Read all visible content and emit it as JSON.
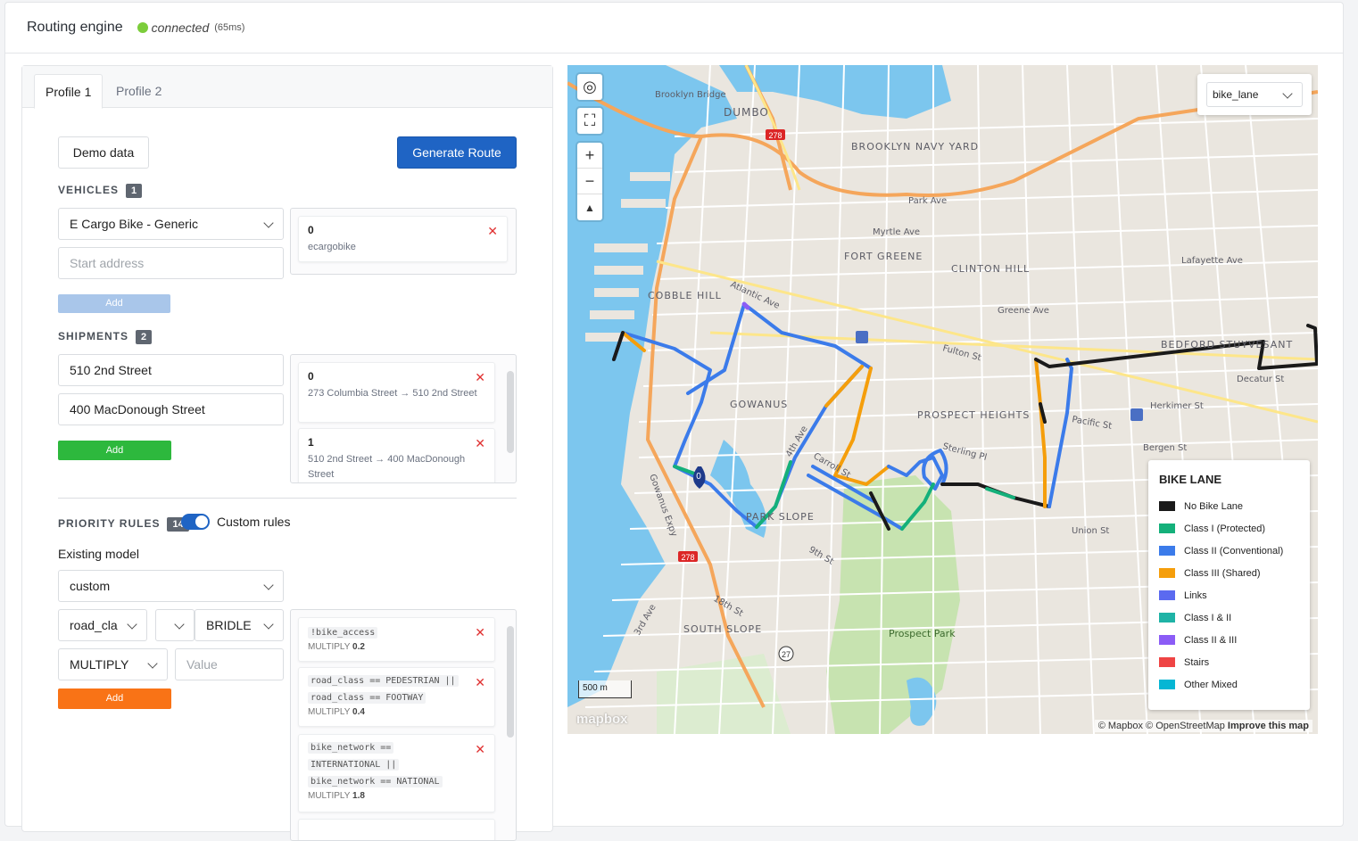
{
  "header": {
    "title": "Routing engine",
    "status": "connected",
    "latency": "(65ms)",
    "status_color": "#7ccd3b"
  },
  "tabs": [
    {
      "label": "Profile 1",
      "active": true
    },
    {
      "label": "Profile 2",
      "active": false
    }
  ],
  "toolbar": {
    "demo_label": "Demo data",
    "generate_label": "Generate Route"
  },
  "vehicles": {
    "label": "VEHICLES",
    "count": "1",
    "selected_type": "E Cargo Bike - Generic",
    "start_placeholder": "Start address",
    "add_label": "Add",
    "cards": [
      {
        "id": "0",
        "sub": "ecargobike"
      }
    ]
  },
  "shipments": {
    "label": "SHIPMENTS",
    "count": "2",
    "field1": "510 2nd Street",
    "field2": "400 MacDonough Street",
    "add_label": "Add",
    "cards": [
      {
        "id": "0",
        "sub": "273 Columbia Street → 510 2nd Street"
      },
      {
        "id": "1",
        "sub": "510 2nd Street → 400 MacDonough Street"
      }
    ]
  },
  "priority": {
    "label": "PRIORITY RULES",
    "count": "14",
    "toggle_label": "Custom rules",
    "toggle_on": true,
    "model_label": "Existing model",
    "model_value": "custom",
    "key_value": "road_cla",
    "op_value": "",
    "val_value": "BRIDLE",
    "action_value": "MULTIPLY",
    "value_placeholder": "Value",
    "add_label": "Add",
    "rules": [
      {
        "lines": [
          "!bike_access"
        ],
        "mult_label": "MULTIPLY",
        "mult": "0.2"
      },
      {
        "lines": [
          "road_class == PEDESTRIAN ||",
          "road_class == FOOTWAY"
        ],
        "mult_label": "MULTIPLY",
        "mult": "0.4"
      },
      {
        "lines": [
          "bike_network ==",
          "INTERNATIONAL ||",
          "bike_network == NATIONAL"
        ],
        "mult_label": "MULTIPLY",
        "mult": "1.8"
      }
    ]
  },
  "map": {
    "layer_select": "bike_lane",
    "scale": "500 m",
    "logo": "mapbox",
    "attribution": "© Mapbox © OpenStreetMap",
    "improve": "Improve this map",
    "marker_label": "0",
    "labels": {
      "dumbo": "DUMBO",
      "navy_yard": "BROOKLYN NAVY YARD",
      "fort_greene": "FORT GREENE",
      "clinton_hill": "CLINTON HILL",
      "cobble_hill": "COBBLE HILL",
      "gowanus": "GOWANUS",
      "prospect_heights": "PROSPECT HEIGHTS",
      "park_slope": "PARK SLOPE",
      "south_slope": "SOUTH SLOPE",
      "prospect_park": "Prospect Park",
      "bed_stuy": "BEDFORD STUYVESANT",
      "brooklyn_bridge": "Brooklyn Bridge",
      "park_ave": "Park Ave",
      "myrtle_ave": "Myrtle Ave",
      "atlantic_ave": "Atlantic Ave",
      "fulton_st": "Fulton St",
      "pacific_st": "Pacific St",
      "union_st": "Union St",
      "bergen_st": "Bergen St",
      "herkimer_st": "Herkimer St",
      "decatur_st": "Decatur St",
      "greene_ave": "Greene Ave",
      "lafayette_ave": "Lafayette Ave",
      "carroll_st": "Carroll St",
      "sterling_pl": "Sterling Pl",
      "gowanus_expy": "Gowanus Expy",
      "third_ave": "3rd Ave",
      "fourth_ave": "4th Ave",
      "ninth_st": "9th St",
      "eighteenth_st": "18th St",
      "i278": "278",
      "r27": "27"
    },
    "legend": {
      "title": "BIKE LANE",
      "items": [
        {
          "label": "No Bike Lane",
          "color": "#1a1a1a"
        },
        {
          "label": "Class I (Protected)",
          "color": "#14b07a"
        },
        {
          "label": "Class II (Conventional)",
          "color": "#3b7bea"
        },
        {
          "label": "Class III (Shared)",
          "color": "#f59e0b"
        },
        {
          "label": "Links",
          "color": "#5b6af0"
        },
        {
          "label": "Class I & II",
          "color": "#1fb3a6"
        },
        {
          "label": "Class II & III",
          "color": "#8b5cf6"
        },
        {
          "label": "Stairs",
          "color": "#ef4444"
        },
        {
          "label": "Other Mixed",
          "color": "#06b6d4"
        }
      ]
    }
  }
}
